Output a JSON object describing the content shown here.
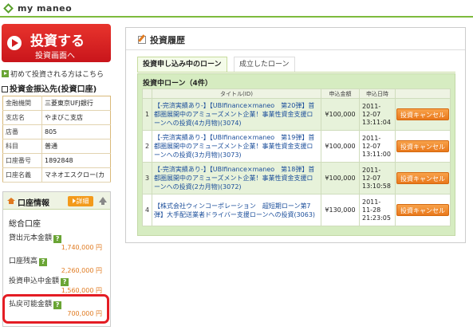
{
  "header": {
    "brand": "my maneo"
  },
  "invest_button": {
    "title": "投資する",
    "subtitle": "投資画面へ"
  },
  "first_link": "初めて投資される方はこちら",
  "bank": {
    "title": "投資金振込先(投資口座)",
    "rows": [
      {
        "label": "金融機関",
        "value": "三菱東京UFJ銀行"
      },
      {
        "label": "支店名",
        "value": "やまびこ支店"
      },
      {
        "label": "店番",
        "value": "805"
      },
      {
        "label": "科目",
        "value": "普通"
      },
      {
        "label": "口座番号",
        "value": "1892848"
      },
      {
        "label": "口座名義",
        "value": "マネオエスクロー(カ"
      }
    ]
  },
  "account": {
    "header": "口座情報",
    "detail_label": "詳細",
    "type": "総合口座",
    "stats": [
      {
        "label": "貸出元本金額",
        "value": "1,740,000 円"
      },
      {
        "label": "口座残高",
        "value": "2,260,000 円"
      },
      {
        "label": "投資申込中金額",
        "value": "1,560,000 円"
      },
      {
        "label": "払戻可能金額",
        "value": "700,000 円"
      }
    ]
  },
  "main": {
    "title": "投資履歴",
    "tabs": [
      {
        "label": "投資申し込み中のローン",
        "active": true
      },
      {
        "label": "成立したローン",
        "active": false
      }
    ],
    "section_title": "投資中ローン（4件）",
    "columns": [
      "タイトル(ID)",
      "申込金額",
      "申込日時"
    ],
    "cancel_label": "投資キャンセル",
    "rows": [
      {
        "no": "1",
        "title": "【-完済実績あり-】【UBIfinance×maneo　第20弾】首都圏展開中のアミューズメント企業！事業性資金支援ローンへの投資(4カ月物)(3074)",
        "amount": "¥100,000",
        "date1": "2011-",
        "date2": "12-07",
        "time": "13:11:04"
      },
      {
        "no": "2",
        "title": "【-完済実績あり-】【UBIfinance×maneo　第19弾】首都圏展開中のアミューズメント企業！事業性資金支援ローンへの投資(3カ月物)(3073)",
        "amount": "¥100,000",
        "date1": "2011-",
        "date2": "12-07",
        "time": "13:11:00"
      },
      {
        "no": "3",
        "title": "【-完済実績あり-】【UBIfinance×maneo　第18弾】首都圏展開中のアミューズメント企業！事業性資金支援ローンへの投資(2カ月物)(3072)",
        "amount": "¥100,000",
        "date1": "2011-",
        "date2": "12-07",
        "time": "13:10:58"
      },
      {
        "no": "4",
        "title": "【株式会社ウィンコーポレーション　超短期ローン第7弾】大手配送業者ドライバー支援ローンへの投資(3063)",
        "amount": "¥130,000",
        "date1": "2011-",
        "date2": "11-28",
        "time": "21:23:05"
      }
    ]
  },
  "colors": {
    "brand_green": "#7dbb3c",
    "invest_red": "#d11c1f",
    "cancel_orange": "#e9781b",
    "link_blue": "#1a4d9a",
    "amount_orange": "#e07a20"
  }
}
